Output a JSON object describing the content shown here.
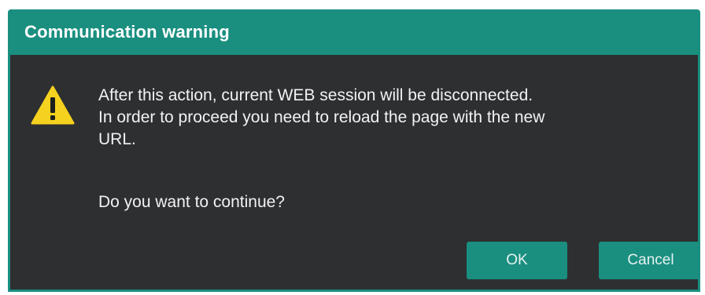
{
  "dialog": {
    "title": "Communication warning",
    "icon": "warning-icon",
    "message_lines": [
      "After this action, current WEB session will be disconnected.",
      "In order to proceed you need to reload the page with the new",
      "URL."
    ],
    "question": "Do you want to continue?",
    "buttons": {
      "ok_label": "OK",
      "cancel_label": "Cancel"
    }
  },
  "colors": {
    "accent": "#1a8f80",
    "background": "#2e2f31",
    "text": "#f2f2f2",
    "warning": "#f5d21f"
  }
}
